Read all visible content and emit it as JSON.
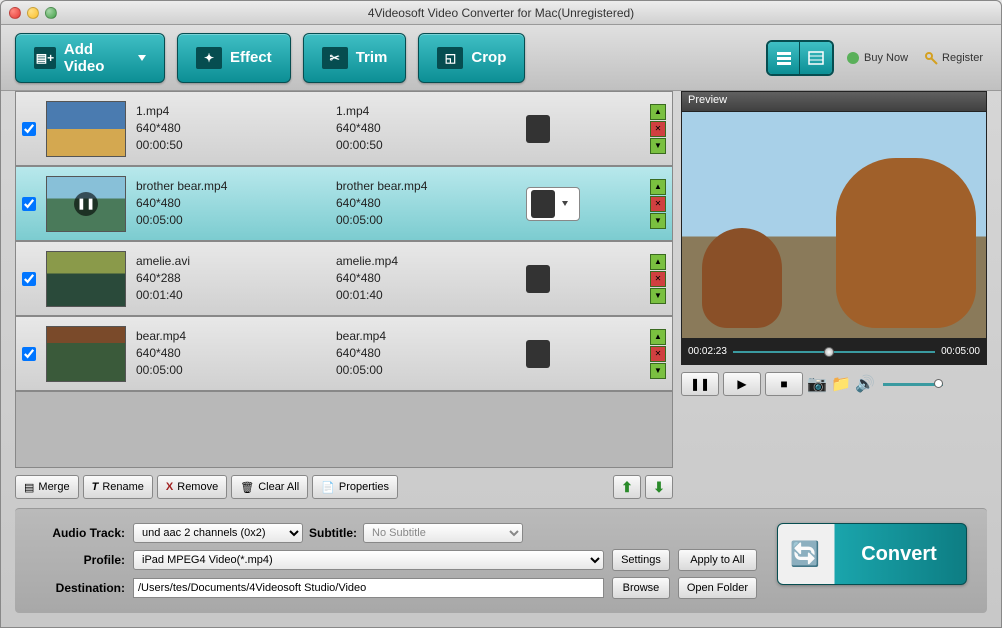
{
  "window": {
    "title": "4Videosoft Video Converter for Mac(Unregistered)"
  },
  "toolbar": {
    "add_video": "Add Video",
    "effect": "Effect",
    "trim": "Trim",
    "crop": "Crop",
    "buy_now": "Buy Now",
    "register": "Register"
  },
  "preview": {
    "label": "Preview",
    "current_time": "00:02:23",
    "total_time": "00:05:00"
  },
  "files": [
    {
      "checked": true,
      "thumb": "fox",
      "src_name": "1.mp4",
      "src_res": "640*480",
      "src_dur": "00:00:50",
      "out_name": "1.mp4",
      "out_res": "640*480",
      "out_dur": "00:00:50",
      "selected": false,
      "playing": false
    },
    {
      "checked": true,
      "thumb": "bear",
      "src_name": "brother bear.mp4",
      "src_res": "640*480",
      "src_dur": "00:05:00",
      "out_name": "brother bear.mp4",
      "out_res": "640*480",
      "out_dur": "00:05:00",
      "selected": true,
      "playing": true
    },
    {
      "checked": true,
      "thumb": "amelie",
      "src_name": "amelie.avi",
      "src_res": "640*288",
      "src_dur": "00:01:40",
      "out_name": "amelie.mp4",
      "out_res": "640*480",
      "out_dur": "00:01:40",
      "selected": false,
      "playing": false
    },
    {
      "checked": true,
      "thumb": "bear2",
      "src_name": "bear.mp4",
      "src_res": "640*480",
      "src_dur": "00:05:00",
      "out_name": "bear.mp4",
      "out_res": "640*480",
      "out_dur": "00:05:00",
      "selected": false,
      "playing": false
    }
  ],
  "list_toolbar": {
    "merge": "Merge",
    "rename": "Rename",
    "remove": "Remove",
    "clear_all": "Clear All",
    "properties": "Properties"
  },
  "settings": {
    "audio_track_label": "Audio Track:",
    "audio_track_value": "und aac 2 channels (0x2)",
    "subtitle_label": "Subtitle:",
    "subtitle_value": "No Subtitle",
    "profile_label": "Profile:",
    "profile_value": "iPad MPEG4 Video(*.mp4)",
    "destination_label": "Destination:",
    "destination_value": "/Users/tes/Documents/4Videosoft Studio/Video",
    "settings_btn": "Settings",
    "apply_all_btn": "Apply to All",
    "browse_btn": "Browse",
    "open_folder_btn": "Open Folder"
  },
  "convert_label": "Convert"
}
